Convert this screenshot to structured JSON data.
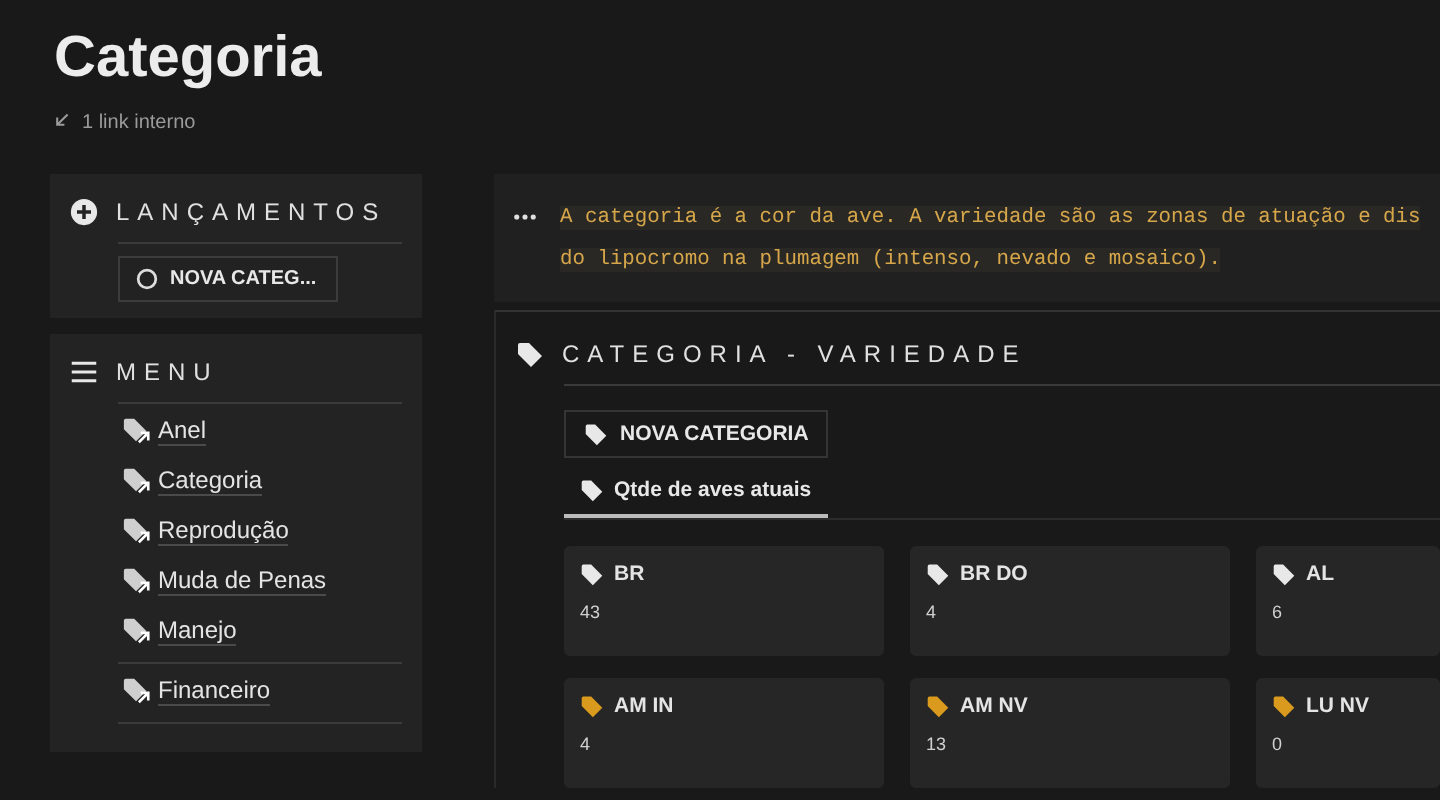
{
  "page": {
    "title": "Categoria",
    "backlinks": "1 link interno"
  },
  "launches": {
    "title": "LANÇAMENTOS",
    "button": "NOVA CATEG..."
  },
  "menu": {
    "title": "MENU",
    "groups": [
      {
        "items": [
          "Anel",
          "Categoria",
          "Reprodução",
          "Muda de Penas",
          "Manejo"
        ]
      },
      {
        "items": [
          "Financeiro"
        ]
      }
    ]
  },
  "callout": {
    "lines": [
      "A categoria é a cor da ave. A variedade são as zonas de atuação e dis",
      "do lipocromo na plumagem (intenso, nevado e mosaico)."
    ]
  },
  "database": {
    "title": "CATEGORIA - VARIEDADE",
    "new_button": "NOVA CATEGORIA",
    "tabs": [
      {
        "label": "Qtde de aves atuais",
        "selected": true
      }
    ],
    "cards": [
      {
        "name": "BR",
        "count": "43",
        "color": "#e8e8e8"
      },
      {
        "name": "BR DO",
        "count": "4",
        "color": "#e8e8e8"
      },
      {
        "name": "AL",
        "count": "6",
        "color": "#e8e8e8"
      },
      {
        "name": "AM IN",
        "count": "4",
        "color": "#d99a1e"
      },
      {
        "name": "AM NV",
        "count": "13",
        "color": "#d99a1e"
      },
      {
        "name": "LU NV",
        "count": "0",
        "color": "#d99a1e"
      }
    ]
  }
}
